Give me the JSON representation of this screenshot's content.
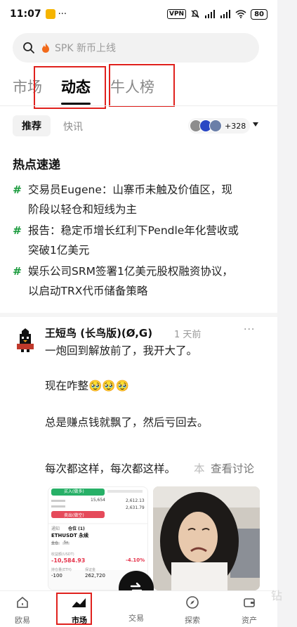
{
  "status_bar": {
    "time": "11:07",
    "more": "···",
    "vpn": "VPN",
    "battery": "80"
  },
  "search": {
    "placeholder": "SPK 新币上线"
  },
  "top_tabs": [
    {
      "label": "市场",
      "active": false
    },
    {
      "label": "动态",
      "active": true
    },
    {
      "label": "牛人榜",
      "active": false
    }
  ],
  "sub_tabs": {
    "recommend": "推荐",
    "news": "快讯",
    "avatar_count": "+328"
  },
  "hot": {
    "title": "热点速递",
    "hash": "#",
    "items": [
      {
        "line1": "交易员Eugene：山寨币未触及价值区，现",
        "line2": "阶段以轻仓和短线为主"
      },
      {
        "line1": "报告：稳定币增长红利下Pendle年化营收或",
        "line2": "突破1亿美元"
      },
      {
        "line1": "娱乐公司SRM签署1亿美元股权融资协议，",
        "line2": "以启动TRX代币储备策略"
      }
    ]
  },
  "post": {
    "author": "王短鸟 (长鸟版)(Ø,G)",
    "time": "1 天前",
    "more": "···",
    "lines": [
      "一炮回到解放前了，我开大了。",
      "现在咋整🥹🥹🥹",
      "总是赚点钱就飘了，然后亏回去。",
      "每次都这样，每次都这样。"
    ],
    "faded": "本",
    "see_discussion": "查看讨论",
    "screenshot": {
      "buy_label": "买入(做多)",
      "sell_label": "卖出(做空)",
      "tab1": "通知",
      "tab2": "仓位 (1)",
      "pair": "ETHUSDT 永续",
      "tag1": "全仓",
      "tag2": "5x",
      "pnl_label": "收益额(USDT)",
      "pnl_value": "-10,584.93",
      "pnl_pct": "-4.10%",
      "amount_label": "持仓量(ETH)",
      "amount_value": "-100",
      "margin_label": "保证金",
      "margin_value": "262,720",
      "price1": "15,654",
      "price2": "2,612.13",
      "price3": "2,631.79"
    }
  },
  "bottom_nav": {
    "items": [
      {
        "label": "欧易",
        "active": false
      },
      {
        "label": "市场",
        "active": true
      },
      {
        "label": "交易",
        "active": false
      },
      {
        "label": "探索",
        "active": false
      },
      {
        "label": "资产",
        "active": false
      }
    ]
  },
  "watermark": "钻",
  "colors": {
    "accent_green": "#1a9b3d",
    "highlight_red": "#e0211d",
    "text_primary": "#111111",
    "text_muted": "#888888"
  }
}
